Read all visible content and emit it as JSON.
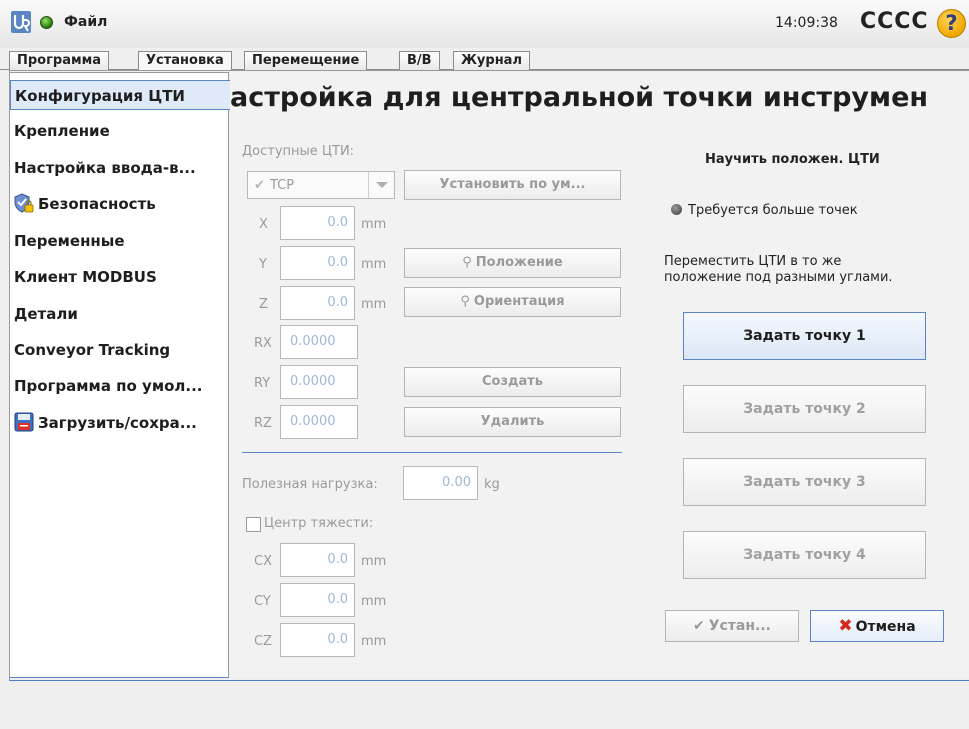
{
  "topbar": {
    "file_menu": "Файл",
    "clock": "14:09:38",
    "robot_name": "CCCC",
    "help": "?"
  },
  "tabs": [
    {
      "label": "Программа"
    },
    {
      "label": "Установка",
      "active": true
    },
    {
      "label": "Перемещение"
    },
    {
      "label": "В/В"
    },
    {
      "label": "Журнал"
    }
  ],
  "sidebar": {
    "items": [
      {
        "label": "Конфигурация ЦТИ",
        "active": true
      },
      {
        "label": "Крепление"
      },
      {
        "label": "Настройка ввода-в..."
      },
      {
        "label": "Безопасность",
        "icon": "shield-lock-icon"
      },
      {
        "label": "Переменные"
      },
      {
        "label": "Клиент MODBUS"
      },
      {
        "label": "Детали"
      },
      {
        "label": "Conveyor Tracking"
      },
      {
        "label": "Программа по умол..."
      },
      {
        "label": "Загрузить/сохра...",
        "icon": "floppy-disk-icon"
      }
    ]
  },
  "page_title": "астройка для центральной точки инструмен",
  "tcp": {
    "available_label": "Доступные ЦТИ:",
    "selected": "TCP",
    "set_default_button": "Установить по ум...",
    "fields": {
      "x": {
        "label": "X",
        "value": "0.0",
        "unit": "mm"
      },
      "y": {
        "label": "Y",
        "value": "0.0",
        "unit": "mm"
      },
      "z": {
        "label": "Z",
        "value": "0.0",
        "unit": "mm"
      },
      "rx": {
        "label": "RX",
        "value": "0.0000"
      },
      "ry": {
        "label": "RY",
        "value": "0.0000"
      },
      "rz": {
        "label": "RZ",
        "value": "0.0000"
      }
    },
    "position_button": "Положение",
    "orientation_button": "Ориентация",
    "create_button": "Создать",
    "delete_button": "Удалить"
  },
  "payload": {
    "label": "Полезная нагрузка:",
    "value": "0.00",
    "unit": "kg"
  },
  "cog": {
    "label": "Центр тяжести:",
    "checked": false,
    "cx": {
      "label": "CX",
      "value": "0.0",
      "unit": "mm"
    },
    "cy": {
      "label": "CY",
      "value": "0.0",
      "unit": "mm"
    },
    "cz": {
      "label": "CZ",
      "value": "0.0",
      "unit": "mm"
    }
  },
  "teach": {
    "heading": "Научить положен. ЦТИ",
    "status": "Требуется больше точек",
    "instruction_line1": "Переместить ЦТИ в то же",
    "instruction_line2": "положение под разными углами.",
    "points": [
      {
        "label": "Задать точку 1",
        "active": true
      },
      {
        "label": "Задать точку 2"
      },
      {
        "label": "Задать точку 3"
      },
      {
        "label": "Задать точку 4"
      }
    ],
    "set_button": "Устан...",
    "cancel_button": "Отмена"
  },
  "colors": {
    "accent": "#5b85c4",
    "ok_status": "#2f8a12",
    "cancel": "#d8281c",
    "help": "#f0a800"
  }
}
